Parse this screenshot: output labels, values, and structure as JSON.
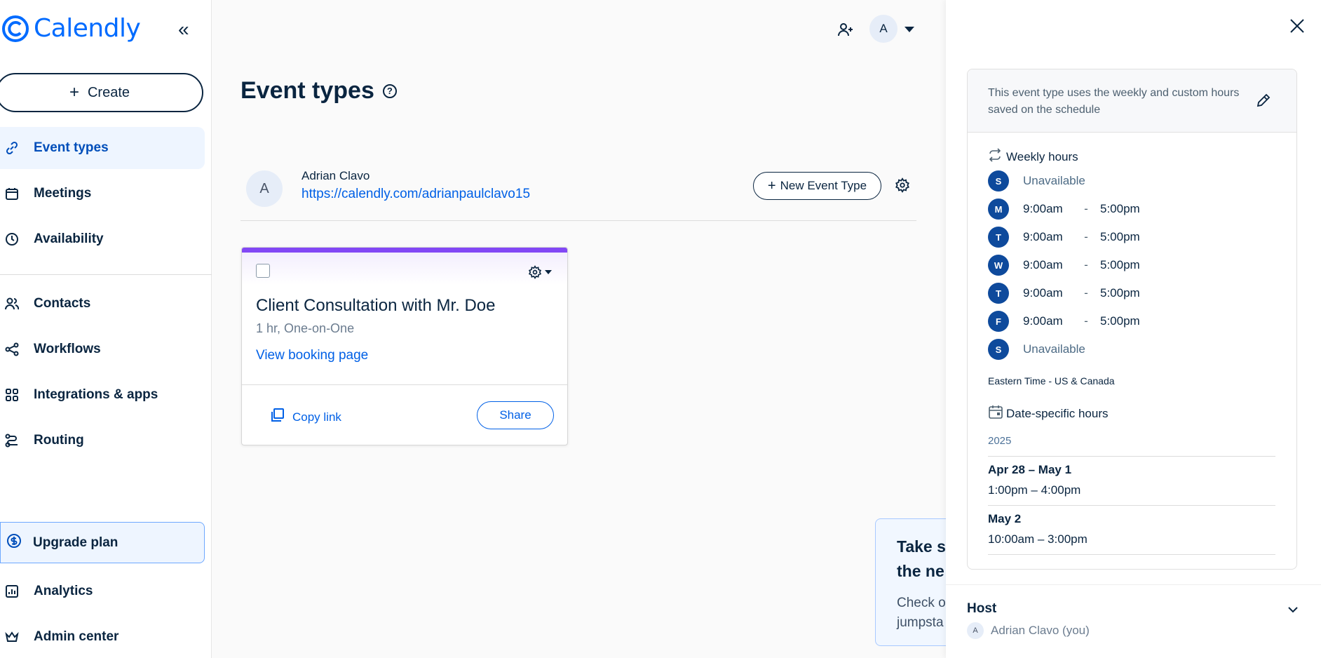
{
  "app": {
    "name": "Calendly",
    "brand_color": "#006bff"
  },
  "sidebar": {
    "create_label": "Create",
    "items": [
      {
        "label": "Event types",
        "icon": "link-icon",
        "active": true
      },
      {
        "label": "Meetings",
        "icon": "calendar-icon"
      },
      {
        "label": "Availability",
        "icon": "clock-icon"
      },
      {
        "label": "Contacts",
        "icon": "contacts-icon"
      },
      {
        "label": "Workflows",
        "icon": "workflow-icon"
      },
      {
        "label": "Integrations & apps",
        "icon": "grid-icon"
      },
      {
        "label": "Routing",
        "icon": "routing-icon"
      }
    ],
    "upgrade_label": "Upgrade plan",
    "bottom_items": [
      {
        "label": "Analytics",
        "icon": "analytics-icon"
      },
      {
        "label": "Admin center",
        "icon": "crown-icon"
      }
    ]
  },
  "header": {
    "avatar_initial": "A"
  },
  "main": {
    "title": "Event types",
    "user": {
      "initial": "A",
      "name": "Adrian Clavo",
      "link": "https://calendly.com/adrianpaulclavo15"
    },
    "new_event_label": "New Event Type",
    "event_card": {
      "accent_color": "#8247f5",
      "title": "Client Consultation with Mr. Doe",
      "subtitle": "1 hr, One-on-One",
      "view_label": "View booking page",
      "copy_label": "Copy link",
      "share_label": "Share"
    },
    "promo": {
      "title": "Take s\nthe ne",
      "body": "Check o\njumpsta"
    }
  },
  "panel": {
    "schedule_note": "This event type uses the weekly and custom hours saved on the schedule",
    "weekly_label": "Weekly hours",
    "days": [
      {
        "letter": "S",
        "unavailable": "Unavailable"
      },
      {
        "letter": "M",
        "start": "9:00am",
        "dash": "-",
        "end": "5:00pm"
      },
      {
        "letter": "T",
        "start": "9:00am",
        "dash": "-",
        "end": "5:00pm"
      },
      {
        "letter": "W",
        "start": "9:00am",
        "dash": "-",
        "end": "5:00pm"
      },
      {
        "letter": "T",
        "start": "9:00am",
        "dash": "-",
        "end": "5:00pm"
      },
      {
        "letter": "F",
        "start": "9:00am",
        "dash": "-",
        "end": "5:00pm"
      },
      {
        "letter": "S",
        "unavailable": "Unavailable"
      }
    ],
    "timezone": "Eastern Time - US & Canada",
    "date_specific_label": "Date-specific hours",
    "year": "2025",
    "date_overrides": [
      {
        "date": "Apr 28 – May 1",
        "hours": "1:00pm – 4:00pm"
      },
      {
        "date": "May 2",
        "hours": "10:00am – 3:00pm"
      }
    ],
    "host_title": "Host",
    "host": {
      "initial": "A",
      "name": "Adrian Clavo (you)"
    }
  }
}
